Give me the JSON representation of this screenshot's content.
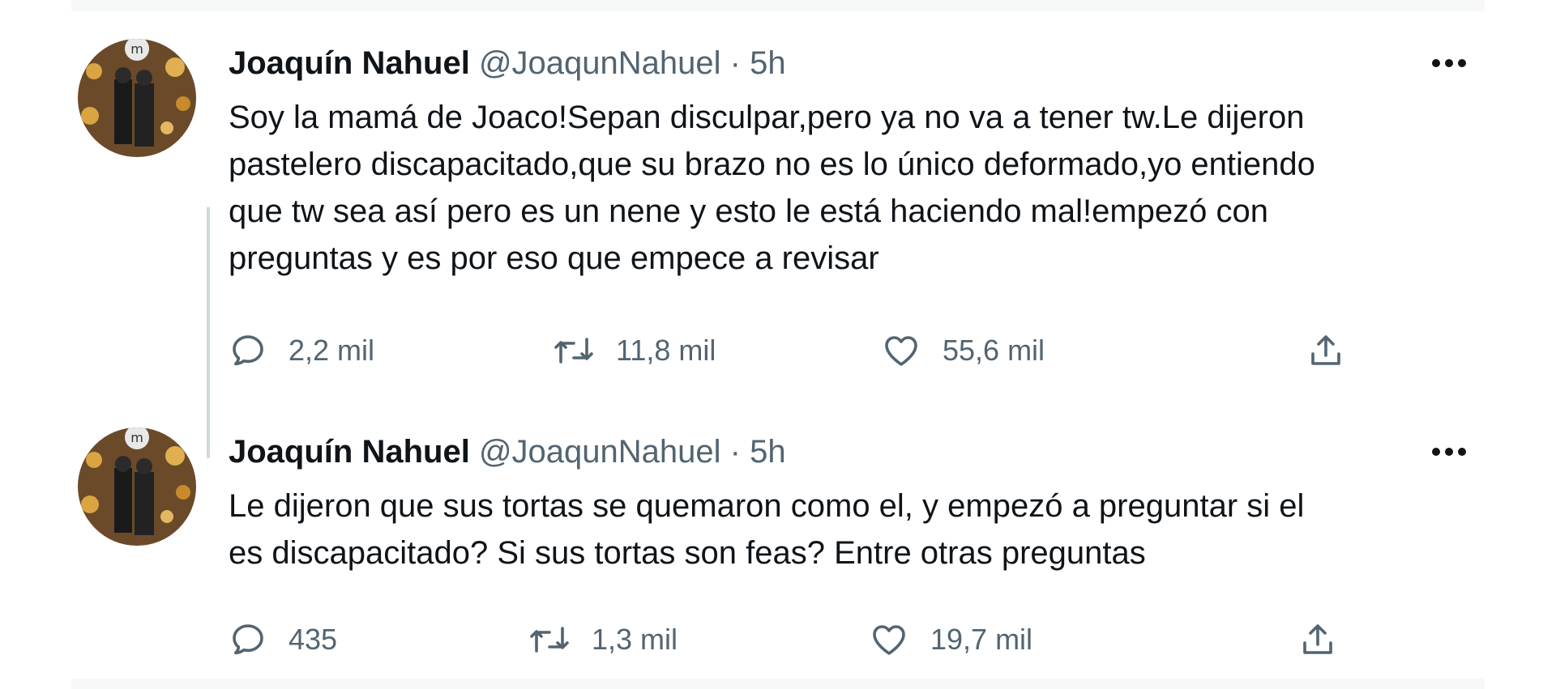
{
  "tweets": [
    {
      "author_name": "Joaquín Nahuel",
      "handle": "@JoaqunNahuel",
      "separator": "·",
      "time": "5h",
      "text": "Soy la mamá de Joaco!Sepan disculpar,pero ya no va a tener tw.Le dijeron\npastelero discapacitado,que su brazo no es lo único deformado,yo entiendo\nque tw sea así pero es un nene y esto le está haciendo mal!empezó con\npreguntas y es por eso que empece a revisar",
      "replies": "2,2 mil",
      "retweets": "11,8 mil",
      "likes": "55,6 mil"
    },
    {
      "author_name": "Joaquín Nahuel",
      "handle": "@JoaqunNahuel",
      "separator": "·",
      "time": "5h",
      "text": "Le dijeron que sus tortas se quemaron como el, y empezó a preguntar si el\nes discapacitado? Si sus tortas son feas? Entre otras preguntas",
      "replies": "435",
      "retweets": "1,3 mil",
      "likes": "19,7 mil"
    }
  ],
  "colors": {
    "text_primary": "#0f1419",
    "text_secondary": "#536471",
    "thread_line": "#cfd9de",
    "background_strip": "#f7f9f9"
  },
  "icons": {
    "reply": "speech-bubble-icon",
    "retweet": "retweet-arrows-icon",
    "like": "heart-outline-icon",
    "share": "share-upload-icon",
    "more": "three-dots-icon"
  }
}
